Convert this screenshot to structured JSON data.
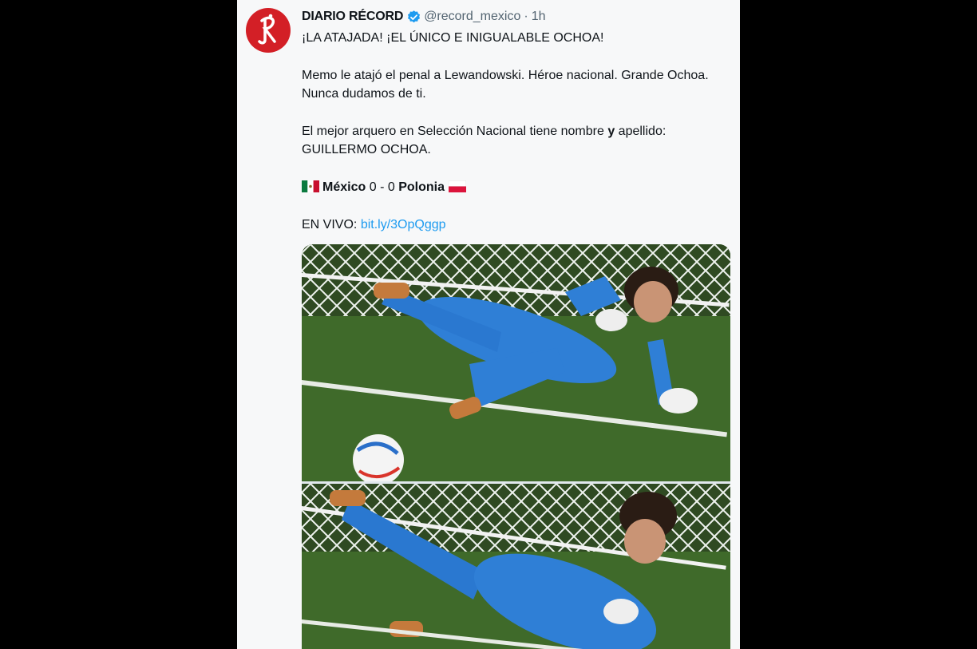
{
  "tweet": {
    "author_name": "DIARIO RÉCORD",
    "handle": "@record_mexico",
    "separator": "·",
    "time": "1h",
    "line1": "¡LA ATAJADA! ¡EL ÚNICO E INIGUALABLE OCHOA!",
    "line2": "Memo le atajó el penal a Lewandowski. Héroe nacional. Grande Ochoa.",
    "line3": "Nunca dudamos de ti.",
    "line4_a": "El mejor arquero en Selección Nacional tiene nombre ",
    "line4_b": "y",
    "line4_c": " apellido:",
    "line5": "GUILLERMO OCHOA.",
    "score": {
      "team1": "México",
      "score1": "0",
      "dash": "-",
      "score2": "0",
      "team2": "Polonia"
    },
    "live_label": "EN VIVO:",
    "link": "bit.ly/3OpQggp"
  },
  "icons": {
    "avatar": "record-logo-icon",
    "verified": "verified-badge-icon"
  },
  "colors": {
    "link": "#1d9bf0",
    "verified": "#1d9bf0",
    "avatar_bg": "#d31f26",
    "jersey": "#2f7fd6",
    "pitch": "#3f6a2a"
  }
}
